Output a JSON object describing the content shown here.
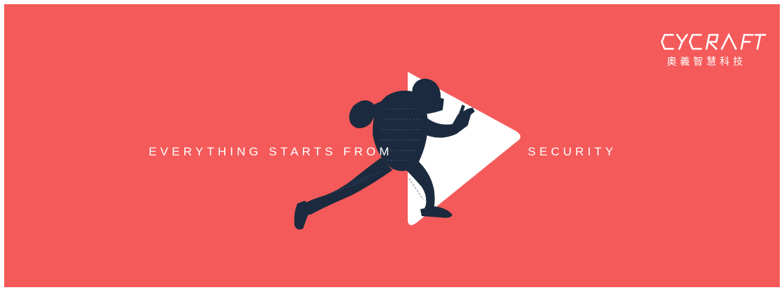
{
  "colors": {
    "background": "#F55A5A",
    "foreground": "#FFFFFF",
    "figure": "#1B2A3E",
    "figure_detail": "#3C5670"
  },
  "banner": {
    "tagline_left": "EVERYTHING STARTS FROM",
    "tagline_right": "SECURITY",
    "icon": "play-arrow-icon",
    "figure": "football-player-silhouette"
  },
  "logo": {
    "wordmark": "CYCRAFT",
    "subtitle": "奧義智慧科技"
  }
}
